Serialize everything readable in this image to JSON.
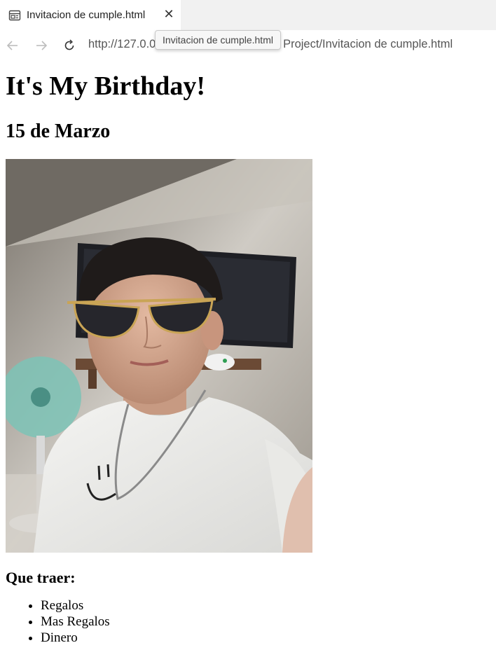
{
  "browser": {
    "tab": {
      "title": "Invitacion de cumple.html",
      "icon": "page-icon",
      "close_icon": "close-icon"
    },
    "toolbar": {
      "back_icon": "arrow-left-icon",
      "forward_icon": "arrow-right-icon",
      "reload_icon": "reload-icon",
      "url_start": "http://127.0.0",
      "url_end": "e Project/Invitacion de cumple.html"
    },
    "tooltip": "Invitacion de cumple.html"
  },
  "page": {
    "heading": "It's My Birthday!",
    "date": "15 de Marzo",
    "photo": {
      "description_icon": "portrait-photo"
    },
    "bring_heading": "Que traer:",
    "bring_items": [
      "Regalos",
      "Mas Regalos",
      "Dinero"
    ]
  }
}
